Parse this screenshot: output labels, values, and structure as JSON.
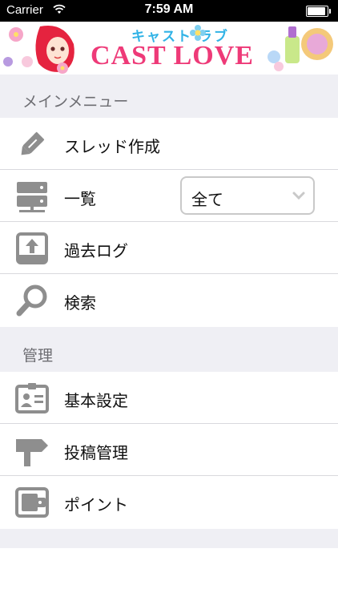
{
  "status_bar": {
    "carrier": "Carrier",
    "time": "7:59 AM"
  },
  "banner": {
    "subtitle": "キャスト ラブ",
    "logo": "CAST LOVE"
  },
  "sections": [
    {
      "header": "メインメニュー",
      "items": [
        {
          "label": "スレッド作成",
          "icon": "pencil-icon"
        },
        {
          "label": "一覧",
          "icon": "server-icon"
        },
        {
          "label": "過去ログ",
          "icon": "archive-icon"
        },
        {
          "label": "検索",
          "icon": "search-icon"
        }
      ]
    },
    {
      "header": "管理",
      "items": [
        {
          "label": "基本設定",
          "icon": "id-card-icon"
        },
        {
          "label": "投稿管理",
          "icon": "signpost-icon"
        },
        {
          "label": "ポイント",
          "icon": "wallet-icon"
        }
      ]
    }
  ],
  "list_filter": {
    "selected": "全て"
  },
  "colors": {
    "accent_pink": "#ee3a78",
    "accent_blue": "#31b3e6",
    "icon_gray": "#8e8e8e",
    "header_bg": "#efeff4"
  }
}
